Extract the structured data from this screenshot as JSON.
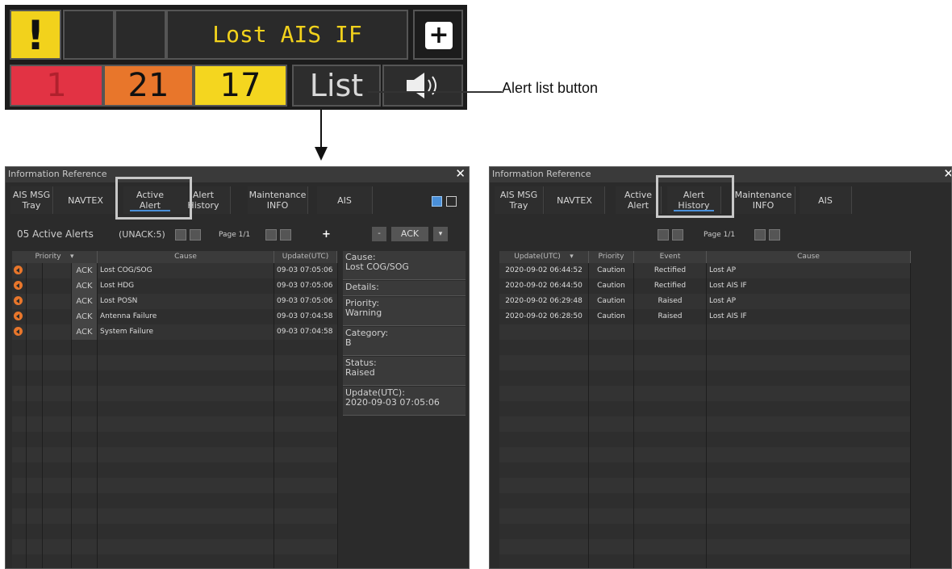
{
  "alert_bar": {
    "warning_glyph": "!",
    "message": "Lost AIS IF",
    "plus_glyph": "+",
    "counts": [
      "1",
      "21",
      "17"
    ],
    "list_label": "List",
    "colors": {
      "alarm": "#e23344",
      "warning": "#e8762b",
      "caution": "#f4d61f"
    }
  },
  "callout": {
    "label": "Alert list button"
  },
  "win1": {
    "title": "Information Reference",
    "tabs": [
      "AIS MSG\nTray",
      "NAVTEX",
      "Active\nAlert",
      "Alert\nHistory",
      "Maintenance\nINFO",
      "AIS"
    ],
    "count_label": "05 Active Alerts",
    "unack": "(UNACK:5)",
    "page": "Page 1/1",
    "ack_label": "ACK",
    "minus": "-",
    "columns": [
      "Priority",
      "Cause",
      "Update(UTC)"
    ],
    "rows": [
      {
        "ack": "ACK",
        "cause": "Lost COG/SOG",
        "time": "09-03 07:05:06"
      },
      {
        "ack": "ACK",
        "cause": "Lost HDG",
        "time": "09-03 07:05:06"
      },
      {
        "ack": "ACK",
        "cause": "Lost POSN",
        "time": "09-03 07:05:06"
      },
      {
        "ack": "ACK",
        "cause": "Antenna Failure",
        "time": "09-03 07:04:58"
      },
      {
        "ack": "ACK",
        "cause": "System Failure",
        "time": "09-03 07:04:58"
      }
    ],
    "details": [
      {
        "label": "Cause:",
        "value": "Lost COG/SOG"
      },
      {
        "label": "Details:",
        "value": ""
      },
      {
        "label": "Priority:",
        "value": "Warning"
      },
      {
        "label": "Category:",
        "value": "B"
      },
      {
        "label": "Status:",
        "value": "Raised"
      },
      {
        "label": "Update(UTC):",
        "value": "2020-09-03 07:05:06"
      }
    ]
  },
  "win2": {
    "title": "Information Reference",
    "tabs": [
      "AIS MSG\nTray",
      "NAVTEX",
      "Active\nAlert",
      "Alert\nHistory",
      "Maintenance\nINFO",
      "AIS"
    ],
    "page": "Page 1/1",
    "columns": [
      "Update(UTC)",
      "Priority",
      "Event",
      "Cause"
    ],
    "rows": [
      {
        "time": "2020-09-02 06:44:52",
        "priority": "Caution",
        "event": "Rectified",
        "cause": "Lost AP"
      },
      {
        "time": "2020-09-02 06:44:50",
        "priority": "Caution",
        "event": "Rectified",
        "cause": "Lost AIS IF"
      },
      {
        "time": "2020-09-02 06:29:48",
        "priority": "Caution",
        "event": "Raised",
        "cause": "Lost AP"
      },
      {
        "time": "2020-09-02 06:28:50",
        "priority": "Caution",
        "event": "Raised",
        "cause": "Lost AIS IF"
      }
    ]
  }
}
